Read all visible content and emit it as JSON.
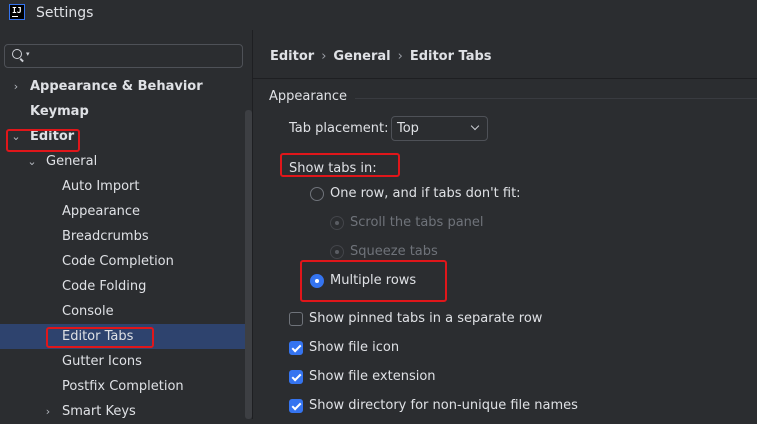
{
  "window": {
    "title": "Settings",
    "app_icon_text": "IJ"
  },
  "search": {
    "value": "",
    "placeholder": ""
  },
  "tree": [
    {
      "label": "Appearance & Behavior",
      "expanded": false,
      "bold": true
    },
    {
      "label": "Keymap",
      "bold": true
    },
    {
      "label": "Editor",
      "expanded": true,
      "bold": true
    },
    {
      "label": "General",
      "expanded": true
    },
    {
      "label": "Auto Import"
    },
    {
      "label": "Appearance"
    },
    {
      "label": "Breadcrumbs"
    },
    {
      "label": "Code Completion"
    },
    {
      "label": "Code Folding"
    },
    {
      "label": "Console"
    },
    {
      "label": "Editor Tabs",
      "selected": true
    },
    {
      "label": "Gutter Icons"
    },
    {
      "label": "Postfix Completion"
    },
    {
      "label": "Smart Keys",
      "expanded": false
    }
  ],
  "breadcrumb": [
    "Editor",
    "General",
    "Editor Tabs"
  ],
  "content": {
    "group_title": "Appearance",
    "tab_placement": {
      "label": "Tab placement:",
      "value": "Top"
    },
    "show_tabs_in": {
      "label": "Show tabs in:",
      "options": [
        {
          "label": "One row, and if tabs don't fit:",
          "checked": false,
          "enabled": true
        },
        {
          "label": "Scroll the tabs panel",
          "checked": false,
          "enabled": false
        },
        {
          "label": "Squeeze tabs",
          "checked": false,
          "enabled": false
        },
        {
          "label": "Multiple rows",
          "checked": true,
          "enabled": true
        }
      ]
    },
    "checkboxes": [
      {
        "label": "Show pinned tabs in a separate row",
        "checked": false
      },
      {
        "label": "Show file icon",
        "checked": true
      },
      {
        "label": "Show file extension",
        "checked": true
      },
      {
        "label": "Show directory for non-unique file names",
        "checked": true
      }
    ]
  },
  "colors": {
    "accent": "#3574f0",
    "highlight_box": "#e0161a",
    "selection": "#2e436e",
    "background": "#2b2d30"
  }
}
